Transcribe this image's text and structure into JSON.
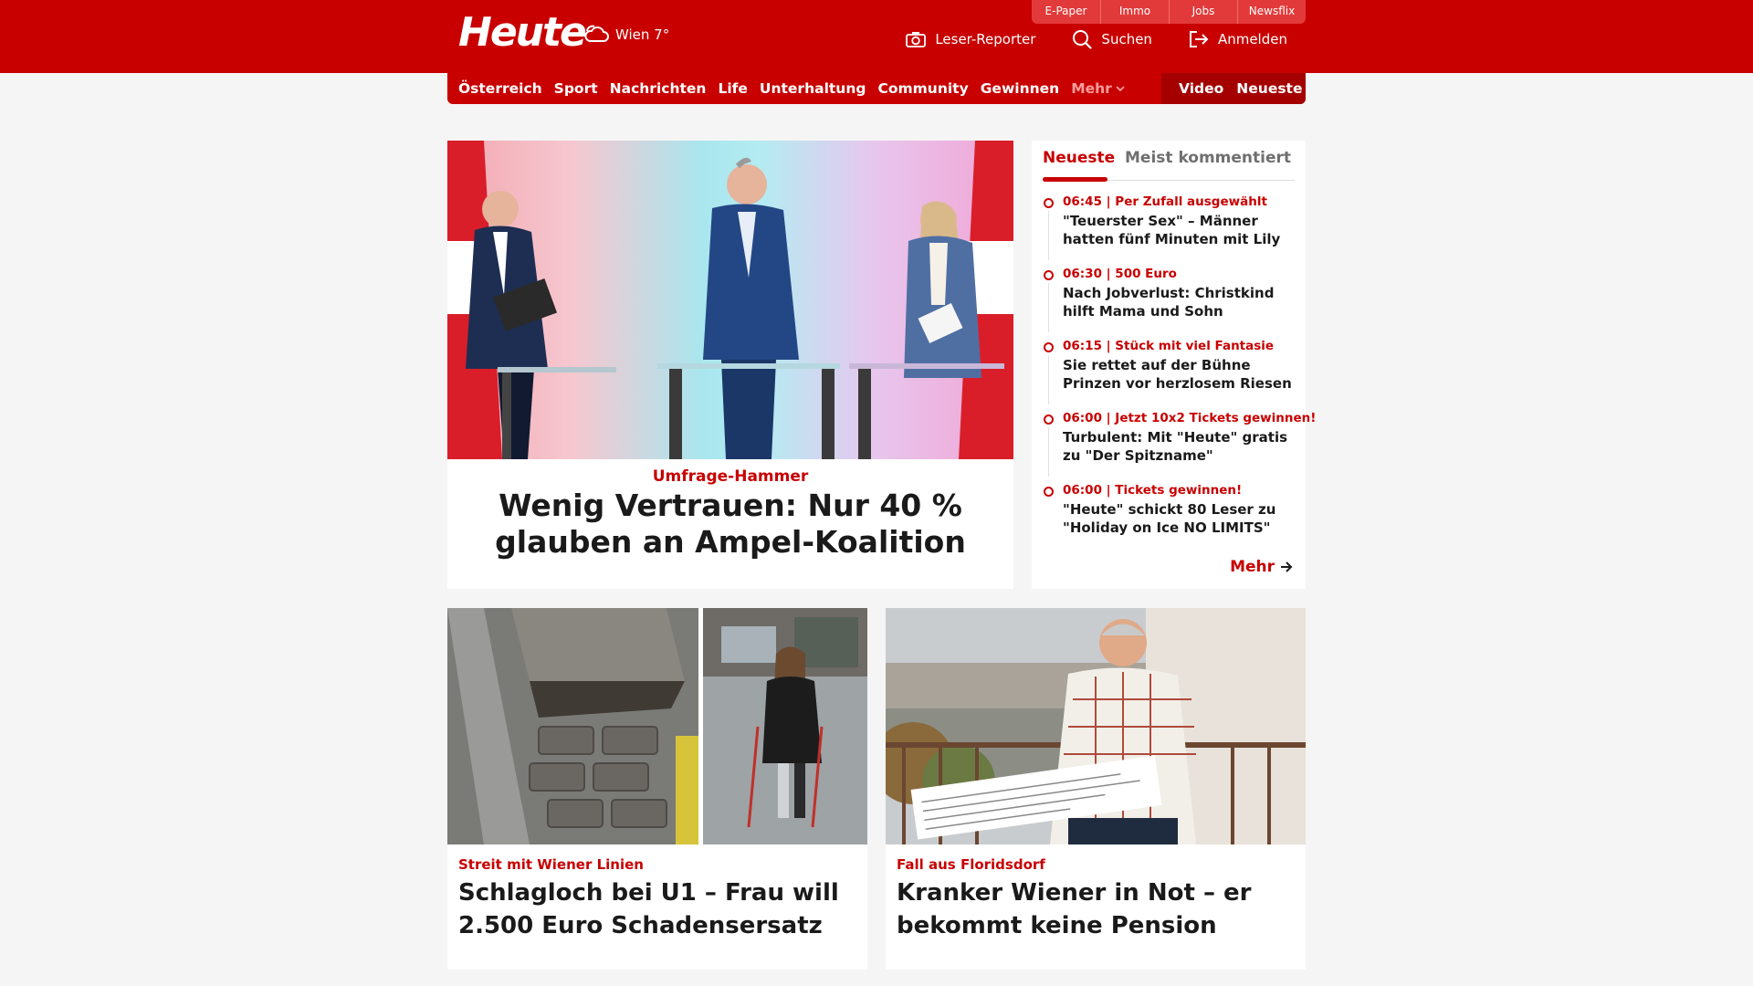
{
  "header": {
    "logo": "Heute",
    "weather": "Wien 7°",
    "top_links": [
      "E-Paper",
      "Immo",
      "Jobs",
      "Newsflix"
    ],
    "actions": {
      "reporter": "Leser-Reporter",
      "search": "Suchen",
      "login": "Anmelden"
    }
  },
  "nav": {
    "items": [
      "Österreich",
      "Sport",
      "Nachrichten",
      "Life",
      "Unterhaltung",
      "Community",
      "Gewinnen"
    ],
    "more": "Mehr",
    "right": [
      "Video",
      "Neueste"
    ]
  },
  "hero": {
    "kicker": "Umfrage-Hammer",
    "title": "Wenig Vertrauen: Nur 40 % glauben an Ampel-Koalition"
  },
  "sidebar": {
    "tabs": [
      "Neueste",
      "Meist kommentiert"
    ],
    "items": [
      {
        "meta": "06:45 | Per Zufall ausgewählt",
        "title": "\"Teuerster Sex\" – Männer hatten fünf Minuten mit Lily"
      },
      {
        "meta": "06:30 | 500 Euro",
        "title": "Nach Jobverlust: Christkind hilft Mama und Sohn"
      },
      {
        "meta": "06:15 | Stück mit viel Fantasie",
        "title": "Sie rettet auf der Bühne Prinzen vor herzlosem Riesen"
      },
      {
        "meta": "06:00 | Jetzt 10x2 Tickets gewinnen!",
        "title": "Turbulent: Mit \"Heute\" gratis zu \"Der Spitzname\""
      },
      {
        "meta": "06:00 | Tickets gewinnen!",
        "title": "\"Heute\" schickt 80 Leser zu \"Holiday on Ice NO LIMITS\""
      }
    ],
    "more": "Mehr"
  },
  "cards": [
    {
      "kicker": "Streit mit Wiener Linien",
      "title": "Schlagloch bei U1 – Frau will 2.500 Euro Schadensersatz"
    },
    {
      "kicker": "Fall aus Floridsdorf",
      "title": "Kranker Wiener in Not – er bekommt keine Pension"
    }
  ],
  "colors": {
    "brand": "#c80000",
    "nav_dark": "#a50000",
    "background": "#f5f5f5"
  }
}
